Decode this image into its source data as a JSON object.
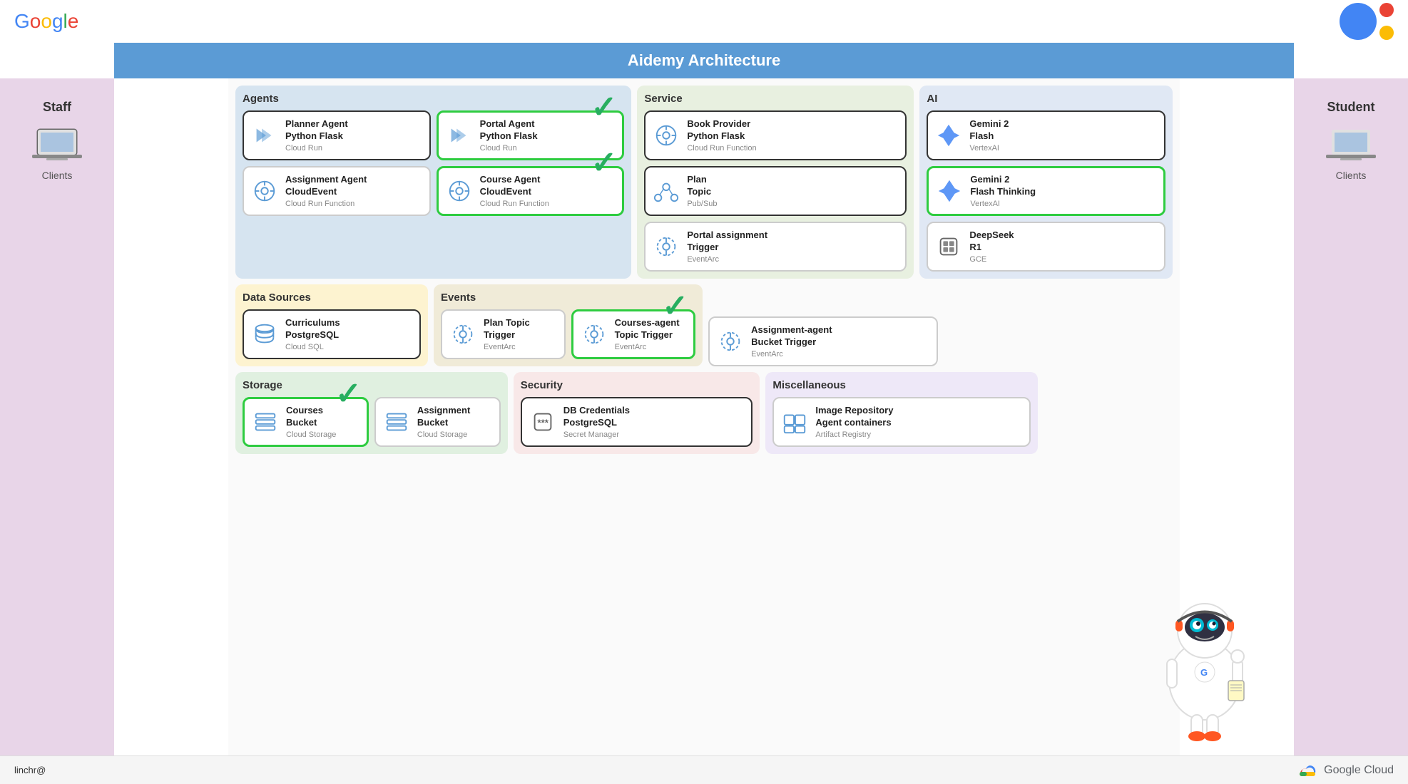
{
  "app": {
    "google_logo": "Google",
    "title": "Aidemy Architecture",
    "bottom_user": "linchr@",
    "google_cloud": "Google Cloud"
  },
  "staff": {
    "label": "Staff",
    "client_label": "Clients"
  },
  "student": {
    "label": "Student",
    "client_label": "Clients"
  },
  "agents": {
    "section_label": "Agents",
    "cards": [
      {
        "id": "planner-agent",
        "title": "Planner Agent\nPython Flask",
        "subtitle": "Cloud Run",
        "icon": "flask",
        "border": "dark",
        "check": false
      },
      {
        "id": "portal-agent",
        "title": "Portal Agent\nPython Flask",
        "subtitle": "Cloud Run",
        "icon": "flask",
        "border": "green",
        "check": true
      },
      {
        "id": "assignment-agent",
        "title": "Assignment Agent\nCloudEvent",
        "subtitle": "Cloud Run Function",
        "icon": "cloudevent",
        "border": "normal",
        "check": false
      },
      {
        "id": "course-agent",
        "title": "Course Agent\nCloudEvent",
        "subtitle": "Cloud Run Function",
        "icon": "cloudevent",
        "border": "green",
        "check": true
      }
    ]
  },
  "service": {
    "section_label": "Service",
    "cards": [
      {
        "id": "book-provider",
        "title": "Book Provider\nPython Flask",
        "subtitle": "Cloud Run Function",
        "icon": "cloudevent",
        "border": "dark",
        "check": false
      },
      {
        "id": "plan-topic",
        "title": "Plan\nTopic",
        "subtitle": "Pub/Sub",
        "icon": "pubsub",
        "border": "dark",
        "check": false
      },
      {
        "id": "portal-assignment-trigger",
        "title": "Portal assignment\nTrigger",
        "subtitle": "EventArc",
        "icon": "eventarc",
        "border": "normal",
        "check": false
      }
    ]
  },
  "ai": {
    "section_label": "AI",
    "cards": [
      {
        "id": "gemini-flash",
        "title": "Gemini 2\nFlash",
        "subtitle": "VertexAI",
        "icon": "gemini",
        "border": "dark",
        "check": false
      },
      {
        "id": "gemini-flash-thinking",
        "title": "Gemini 2\nFlash Thinking",
        "subtitle": "VertexAI",
        "icon": "gemini",
        "border": "green",
        "check": false
      },
      {
        "id": "deepseek-r1",
        "title": "DeepSeek\nR1",
        "subtitle": "GCE",
        "icon": "chip",
        "border": "normal",
        "check": false
      }
    ]
  },
  "data_sources": {
    "section_label": "Data Sources",
    "cards": [
      {
        "id": "curriculums-postgresql",
        "title": "Curriculums\nPostgreSQL",
        "subtitle": "Cloud SQL",
        "icon": "sql",
        "border": "dark",
        "check": false
      }
    ]
  },
  "events": {
    "section_label": "Events",
    "cards": [
      {
        "id": "plan-topic-trigger",
        "title": "Plan Topic\nTrigger",
        "subtitle": "EventArc",
        "icon": "eventarc",
        "border": "normal",
        "check": false
      },
      {
        "id": "courses-agent-topic-trigger",
        "title": "Courses-agent\nTopic Trigger",
        "subtitle": "EventArc",
        "icon": "eventarc",
        "border": "green",
        "check": true
      },
      {
        "id": "assignment-agent-bucket-trigger",
        "title": "Assignment-agent\nBucket Trigger",
        "subtitle": "EventArc",
        "icon": "eventarc",
        "border": "normal",
        "check": false
      }
    ]
  },
  "storage": {
    "section_label": "Storage",
    "cards": [
      {
        "id": "courses-bucket",
        "title": "Courses\nBucket",
        "subtitle": "Cloud Storage",
        "icon": "storage",
        "border": "green",
        "check": true
      },
      {
        "id": "assignment-bucket",
        "title": "Assignment\nBucket",
        "subtitle": "Cloud Storage",
        "icon": "storage",
        "border": "normal",
        "check": false
      }
    ]
  },
  "security": {
    "section_label": "Security",
    "cards": [
      {
        "id": "db-credentials",
        "title": "DB Credentials\nPostgreSQL",
        "subtitle": "Secret Manager",
        "icon": "secret",
        "border": "dark",
        "check": false
      }
    ]
  },
  "misc": {
    "section_label": "Miscellaneous",
    "cards": [
      {
        "id": "image-repository",
        "title": "Image Repository\nAgent containers",
        "subtitle": "Artifact Registry",
        "icon": "registry",
        "border": "normal",
        "check": false
      }
    ]
  }
}
